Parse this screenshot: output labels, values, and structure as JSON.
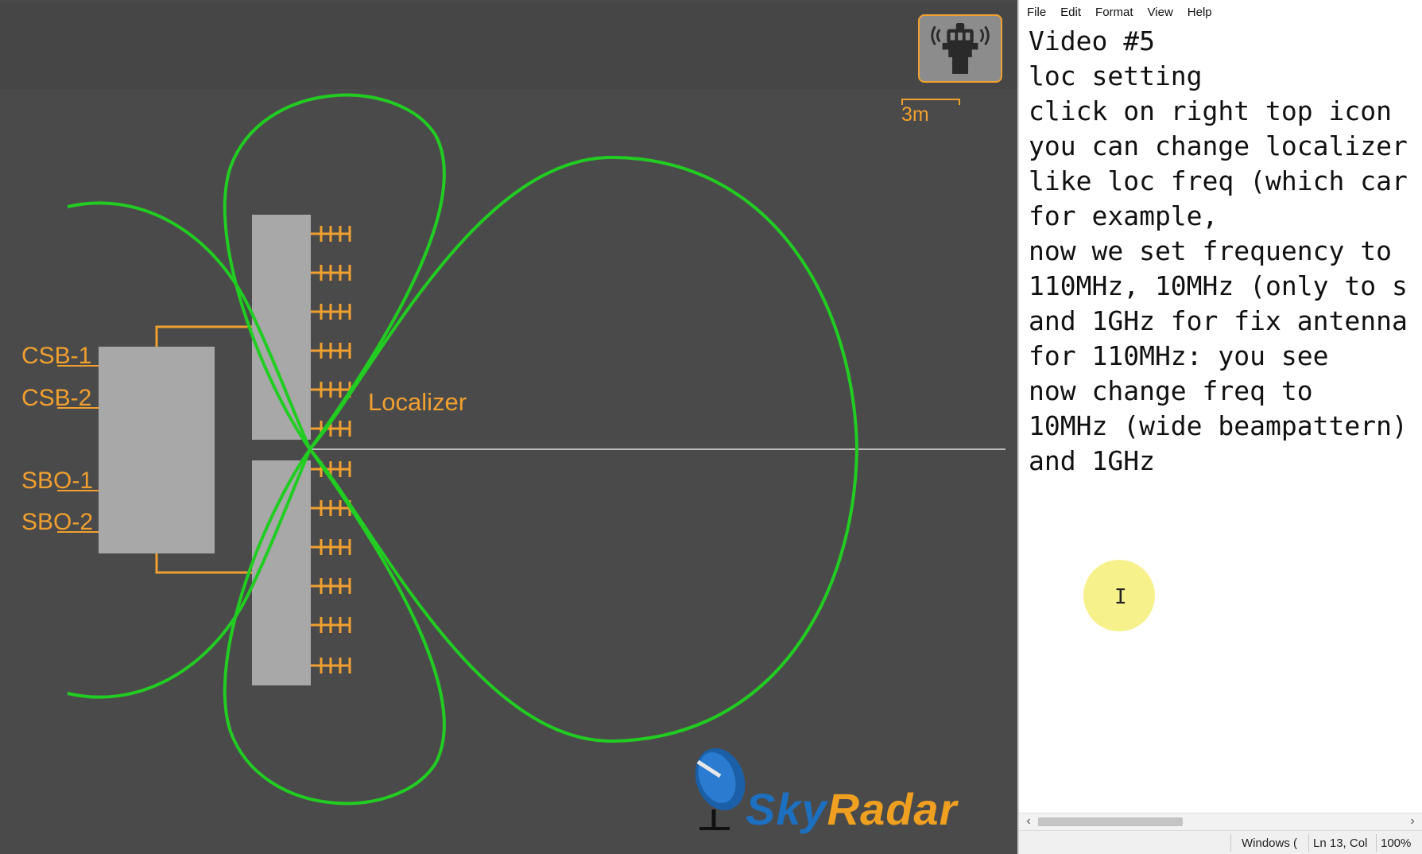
{
  "simulator": {
    "port_labels": [
      "CSB-1",
      "CSB-2",
      "SBO-1",
      "SBO-2"
    ],
    "antenna_label": "Localizer",
    "scale_label": "3m",
    "tower_icon": "control-tower-icon",
    "logo": {
      "sky": "Sky",
      "radar": "Radar",
      "icon": "radar-dish-icon"
    },
    "colors": {
      "background": "#4a4a4a",
      "beam": "#22cc22",
      "accent": "#f0a030",
      "block": "#a8a8a8"
    }
  },
  "notepad": {
    "menu": [
      "File",
      "Edit",
      "Format",
      "View",
      "Help"
    ],
    "lines": [
      "Video #5",
      "loc setting",
      "click on right top icon",
      "you can change localizer",
      "like loc freq (which car",
      "for example,",
      "now we set frequency to",
      "110MHz, 10MHz (only to s",
      "and 1GHz for fix antenna",
      "for 110MHz: you see",
      "now change freq to",
      "10MHz (wide beampattern)",
      "and 1GHz"
    ],
    "status": {
      "encoding": "Windows (",
      "position": "Ln 13, Col",
      "zoom": "100%"
    },
    "cursor_glyph": "I"
  }
}
